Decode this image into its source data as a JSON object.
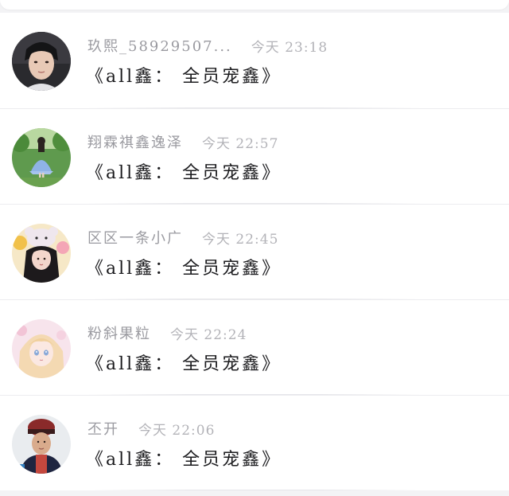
{
  "comments": [
    {
      "nickname": "玖熙_58929507...",
      "time": "今天 23:18",
      "content": "《all鑫： 全员宠鑫》",
      "avatar_icon": "male-portrait-avatar"
    },
    {
      "nickname": "翔霖祺鑫逸泽",
      "time": "今天 22:57",
      "content": "《all鑫： 全员宠鑫》",
      "avatar_icon": "girl-in-garden-avatar"
    },
    {
      "nickname": "区区一条小广",
      "time": "今天 22:45",
      "content": "《all鑫： 全员宠鑫》",
      "avatar_icon": "girl-with-bear-hat-avatar"
    },
    {
      "nickname": "粉斜果粒",
      "time": "今天 22:24",
      "content": "《all鑫： 全员宠鑫》",
      "avatar_icon": "anime-girl-avatar"
    },
    {
      "nickname": "丕开",
      "time": "今天 22:06",
      "content": "《all鑫： 全员宠鑫》",
      "avatar_icon": "elder-woman-avatar"
    }
  ],
  "colors": {
    "background": "#f3f3f5",
    "card": "#ffffff",
    "nickname": "#9a9aa0",
    "time": "#b3b3b8",
    "content": "#1c1c1f"
  }
}
